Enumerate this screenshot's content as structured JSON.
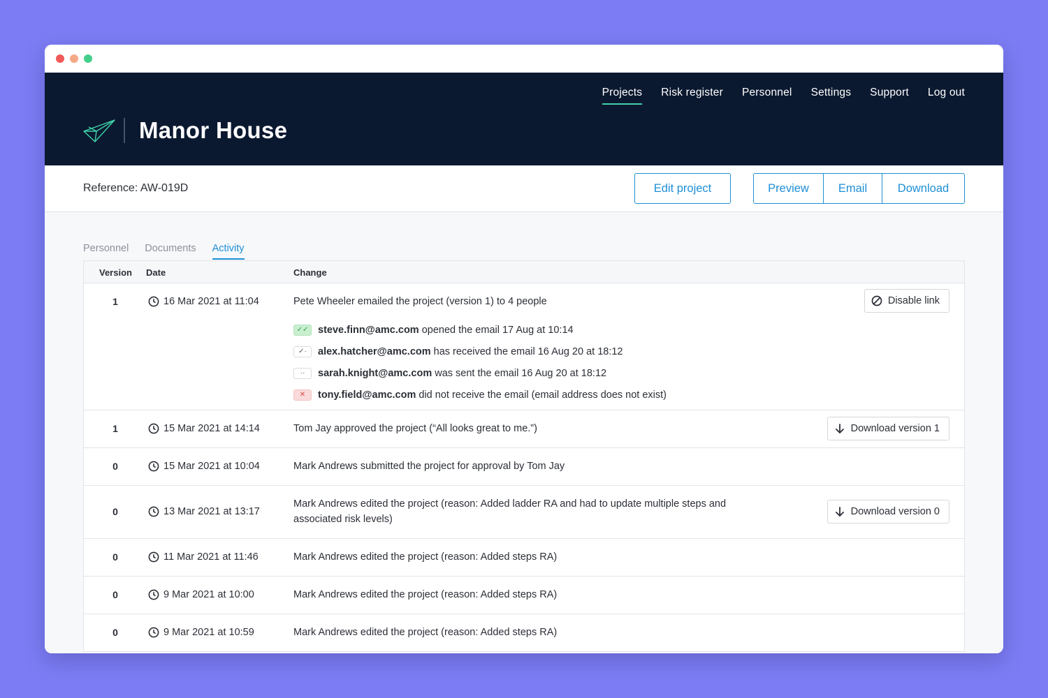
{
  "header": {
    "project_title": "Manor House",
    "nav": [
      {
        "label": "Projects",
        "active": true
      },
      {
        "label": "Risk register",
        "active": false
      },
      {
        "label": "Personnel",
        "active": false
      },
      {
        "label": "Settings",
        "active": false
      },
      {
        "label": "Support",
        "active": false
      },
      {
        "label": "Log out",
        "active": false
      }
    ],
    "logo_icon": "paper-plane-icon",
    "accent_color": "#3fd1a8",
    "background_color": "#0b1930"
  },
  "toolbar": {
    "reference": "Reference: AW-019D",
    "edit_label": "Edit project",
    "preview_label": "Preview",
    "email_label": "Email",
    "download_label": "Download",
    "button_color": "#1e8fd6"
  },
  "tabs": [
    {
      "label": "Personnel",
      "active": false
    },
    {
      "label": "Documents",
      "active": false
    },
    {
      "label": "Activity",
      "active": true
    }
  ],
  "table": {
    "headers": {
      "version": "Version",
      "date": "Date",
      "change": "Change"
    },
    "rows": [
      {
        "version": "1",
        "date": "16 Mar 2021 at 11:04",
        "change": "Pete Wheeler emailed the project (version 1) to 4 people",
        "action": "Disable link",
        "action_icon": "ban-icon",
        "recipients": [
          {
            "status": "opened",
            "email": "steve.finn@amc.com",
            "text": "opened the email 17 Aug at 10:14"
          },
          {
            "status": "received",
            "email": "alex.hatcher@amc.com",
            "text": "has received the email 16 Aug 20 at 18:12"
          },
          {
            "status": "sent",
            "email": "sarah.knight@amc.com",
            "text": "was sent the email 16 Aug 20 at 18:12"
          },
          {
            "status": "failed",
            "email": "tony.field@amc.com",
            "text": "did not receive the email (email address does not exist)"
          }
        ]
      },
      {
        "version": "1",
        "date": "15 Mar 2021 at 14:14",
        "change": "Tom Jay approved the project (“All looks great to me.”)",
        "action": "Download version 1",
        "action_icon": "arrow-down-icon"
      },
      {
        "version": "0",
        "date": "15 Mar 2021 at 10:04",
        "change": "Mark Andrews submitted the project for approval by Tom Jay"
      },
      {
        "version": "0",
        "date": "13 Mar 2021 at 13:17",
        "change": "Mark Andrews edited the project (reason: Added ladder RA and had to update multiple steps and associated risk levels)",
        "action": "Download version 0",
        "action_icon": "arrow-down-icon"
      },
      {
        "version": "0",
        "date": "11 Mar 2021 at 11:46",
        "change": "Mark Andrews edited the project (reason: Added steps RA)"
      },
      {
        "version": "0",
        "date": "9 Mar 2021 at 10:00",
        "change": "Mark Andrews edited the project (reason: Added steps RA)"
      },
      {
        "version": "0",
        "date": "9 Mar 2021 at 10:59",
        "change": "Mark Andrews edited the project (reason: Added steps RA)"
      }
    ]
  }
}
